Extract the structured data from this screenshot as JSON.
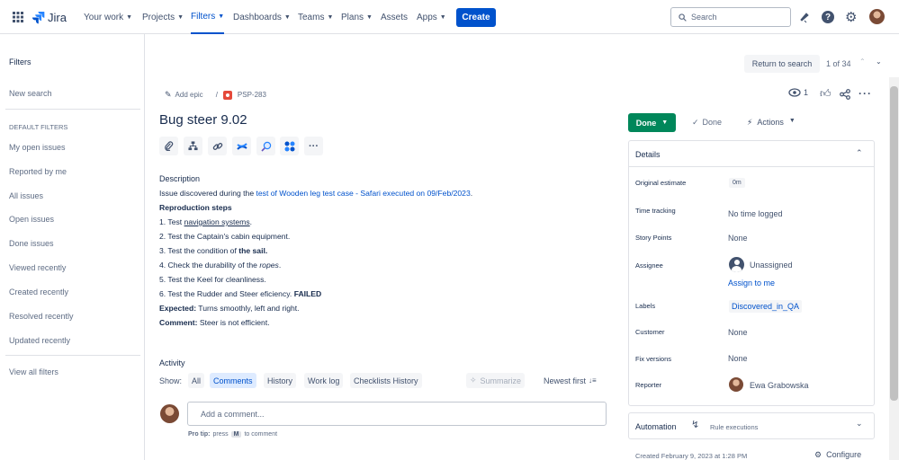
{
  "topbar": {
    "logo": "Jira",
    "nav": [
      "Your work",
      "Projects",
      "Filters",
      "Dashboards",
      "Teams",
      "Plans",
      "Assets",
      "Apps"
    ],
    "create": "Create",
    "search_placeholder": "Search"
  },
  "sidebar": {
    "title": "Filters",
    "new_search": "New search",
    "default_heading": "DEFAULT FILTERS",
    "filters": [
      "My open issues",
      "Reported by me",
      "All issues",
      "Open issues",
      "Done issues",
      "Viewed recently",
      "Created recently",
      "Resolved recently",
      "Updated recently"
    ],
    "view_all": "View all filters"
  },
  "pager": {
    "return": "Return to search",
    "count": "1 of 34"
  },
  "issue": {
    "add_epic": "Add epic",
    "sep": "/",
    "key": "PSP-283",
    "title": "Bug steer 9.02",
    "watchers": "1",
    "description": {
      "heading": "Description",
      "line1_pre": "Issue discovered during the ",
      "line1_link": "test of Wooden leg test case - Safari executed on 09/Feb/2023",
      "line1_post": ".",
      "repro": "Reproduction steps",
      "s1_pre": "1. Test ",
      "s1_link": "navigation systems",
      "s1_post": ".",
      "s2": "2. Test the Captain's cabin equipment.",
      "s3_pre": "3. Test the condition of ",
      "s3_bold": "the sail.",
      "s4_pre": "4. Check the durability of the ",
      "s4_em": "ropes",
      "s4_post": ".",
      "s5": "5. Test the Keel for cleanliness.",
      "s6_pre": "6. Test the Rudder and Steer eficiency. ",
      "s6_bold": "FAILED",
      "exp_label": "Expected:",
      "exp_text": " Turns smoothly, left and right.",
      "com_label": "Comment:",
      "com_text": " Steer is not efficient."
    }
  },
  "activity": {
    "heading": "Activity",
    "show": "Show:",
    "tabs": [
      "All",
      "Comments",
      "History",
      "Work log",
      "Checklists History"
    ],
    "summarize": "Summarize",
    "sort": "Newest first",
    "comment_placeholder": "Add a comment...",
    "protip_label": "Pro tip:",
    "protip_text": "press",
    "protip_key": "M",
    "protip_post": "to comment"
  },
  "status": {
    "button": "Done",
    "resolution": "Done",
    "actions": "Actions"
  },
  "details": {
    "heading": "Details",
    "fields": [
      {
        "label": "Original estimate",
        "value": "0m"
      },
      {
        "label": "Time tracking",
        "value": "No time logged"
      },
      {
        "label": "Story Points",
        "value": "None"
      },
      {
        "label": "Assignee",
        "value": "Unassigned",
        "action": "Assign to me"
      },
      {
        "label": "Labels",
        "value": "Discovered_in_QA"
      },
      {
        "label": "Customer",
        "value": "None"
      },
      {
        "label": "Fix versions",
        "value": "None"
      },
      {
        "label": "Reporter",
        "value": "Ewa Grabowska"
      }
    ]
  },
  "automation": {
    "title": "Automation",
    "sub": "Rule executions"
  },
  "footer": {
    "created": "Created February 9, 2023 at 1:28 PM",
    "configure": "Configure"
  },
  "colors": {
    "accent": "#0052cc",
    "done_green": "#00875a",
    "border": "#dfe1e6",
    "bug_red": "#e5493a"
  }
}
